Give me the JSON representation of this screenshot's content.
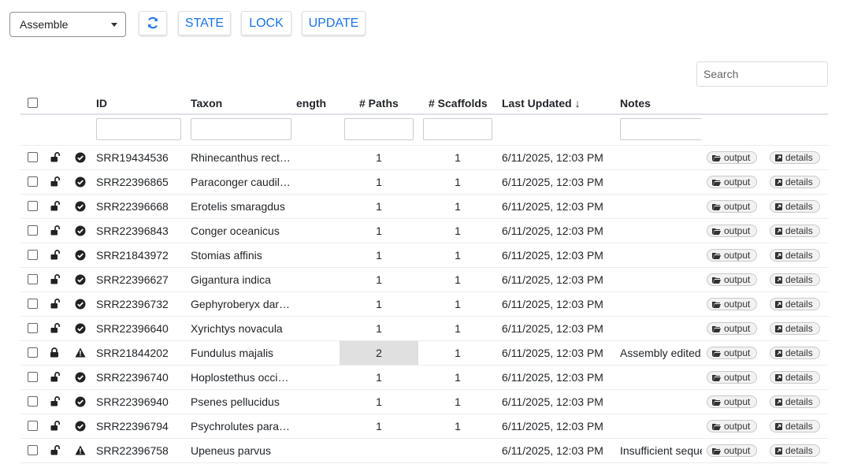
{
  "toolbar": {
    "select_value": "Assemble",
    "refresh_icon": "refresh-icon",
    "state_label": "STATE",
    "lock_label": "LOCK",
    "update_label": "UPDATE"
  },
  "search": {
    "placeholder": "Search"
  },
  "colors": {
    "accent": "#1a73e8",
    "highlight": "#e0e0e0"
  },
  "table": {
    "headers": {
      "id": "ID",
      "taxon": "Taxon",
      "length": "ength",
      "paths": "# Paths",
      "scaffolds": "# Scaffolds",
      "updated": "Last Updated ↓",
      "notes": "Notes"
    },
    "buttons": {
      "output": "output",
      "details": "details"
    },
    "rows": [
      {
        "id": "SRR19434536",
        "taxon": "Rhinecanthus rect…",
        "paths": "1",
        "scaffolds": "1",
        "updated": "6/11/2025, 12:03 PM",
        "notes": "",
        "locked": false,
        "status": "ok",
        "highlight": false
      },
      {
        "id": "SRR22396865",
        "taxon": "Paraconger caudil…",
        "paths": "1",
        "scaffolds": "1",
        "updated": "6/11/2025, 12:03 PM",
        "notes": "",
        "locked": false,
        "status": "ok",
        "highlight": false
      },
      {
        "id": "SRR22396668",
        "taxon": "Erotelis smaragdus",
        "paths": "1",
        "scaffolds": "1",
        "updated": "6/11/2025, 12:03 PM",
        "notes": "",
        "locked": false,
        "status": "ok",
        "highlight": false
      },
      {
        "id": "SRR22396843",
        "taxon": "Conger oceanicus",
        "paths": "1",
        "scaffolds": "1",
        "updated": "6/11/2025, 12:03 PM",
        "notes": "",
        "locked": false,
        "status": "ok",
        "highlight": false
      },
      {
        "id": "SRR21843972",
        "taxon": "Stomias affinis",
        "paths": "1",
        "scaffolds": "1",
        "updated": "6/11/2025, 12:03 PM",
        "notes": "",
        "locked": false,
        "status": "ok",
        "highlight": false
      },
      {
        "id": "SRR22396627",
        "taxon": "Gigantura indica",
        "paths": "1",
        "scaffolds": "1",
        "updated": "6/11/2025, 12:03 PM",
        "notes": "",
        "locked": false,
        "status": "ok",
        "highlight": false
      },
      {
        "id": "SRR22396732",
        "taxon": "Gephyroberyx dar…",
        "paths": "1",
        "scaffolds": "1",
        "updated": "6/11/2025, 12:03 PM",
        "notes": "",
        "locked": false,
        "status": "ok",
        "highlight": false
      },
      {
        "id": "SRR22396640",
        "taxon": "Xyrichtys novacula",
        "paths": "1",
        "scaffolds": "1",
        "updated": "6/11/2025, 12:03 PM",
        "notes": "",
        "locked": false,
        "status": "ok",
        "highlight": false
      },
      {
        "id": "SRR21844202",
        "taxon": "Fundulus majalis",
        "paths": "2",
        "scaffolds": "1",
        "updated": "6/11/2025, 12:03 PM",
        "notes": "Assembly edited",
        "locked": true,
        "status": "warn",
        "highlight": true
      },
      {
        "id": "SRR22396740",
        "taxon": "Hoplostethus occi…",
        "paths": "1",
        "scaffolds": "1",
        "updated": "6/11/2025, 12:03 PM",
        "notes": "",
        "locked": false,
        "status": "ok",
        "highlight": false
      },
      {
        "id": "SRR22396940",
        "taxon": "Psenes pellucidus",
        "paths": "1",
        "scaffolds": "1",
        "updated": "6/11/2025, 12:03 PM",
        "notes": "",
        "locked": false,
        "status": "ok",
        "highlight": false
      },
      {
        "id": "SRR22396794",
        "taxon": "Psychrolutes para…",
        "paths": "1",
        "scaffolds": "1",
        "updated": "6/11/2025, 12:03 PM",
        "notes": "",
        "locked": false,
        "status": "ok",
        "highlight": false
      },
      {
        "id": "SRR22396758",
        "taxon": "Upeneus parvus",
        "paths": "",
        "scaffolds": "",
        "updated": "6/11/2025, 12:03 PM",
        "notes": "Insufficient seque",
        "locked": false,
        "status": "warn",
        "highlight": false
      }
    ]
  }
}
